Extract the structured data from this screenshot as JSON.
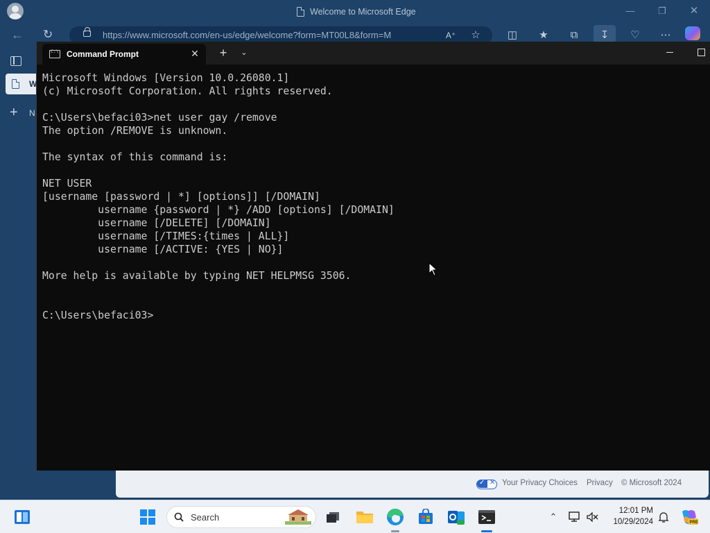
{
  "edge": {
    "window_title": "Welcome to Microsoft Edge",
    "address_url": "https://www.microsoft.com/en-us/edge/welcome?form=MT00L8&form=M",
    "sidebar": {
      "active_tab_label": "W",
      "new_tab_label": "N"
    },
    "footer": {
      "privacy_choices": "Your Privacy Choices",
      "privacy": "Privacy",
      "copyright": "© Microsoft 2024"
    },
    "icons": [
      "profile-avatar-icon",
      "back-arrow-icon",
      "refresh-icon",
      "lock-icon",
      "read-aloud-icon",
      "favorite-star-icon",
      "split-screen-icon",
      "favorites-icon",
      "collections-icon",
      "downloads-icon",
      "browser-essentials-icon",
      "more-icon",
      "copilot-icon"
    ]
  },
  "terminal": {
    "tab_title": "Command Prompt",
    "lines": [
      "Microsoft Windows [Version 10.0.26080.1]",
      "(c) Microsoft Corporation. All rights reserved.",
      "",
      "C:\\Users\\befaci03>net user gay /remove",
      "The option /REMOVE is unknown.",
      "",
      "The syntax of this command is:",
      "",
      "NET USER",
      "[username [password | *] [options]] [/DOMAIN]",
      "         username {password | *} /ADD [options] [/DOMAIN]",
      "         username [/DELETE] [/DOMAIN]",
      "         username [/TIMES:{times | ALL}]",
      "         username [/ACTIVE: {YES | NO}]",
      "",
      "More help is available by typing NET HELPMSG 3506.",
      "",
      "",
      "C:\\Users\\befaci03>"
    ],
    "colors": {
      "background": "#0c0c0c",
      "text": "#cccccc"
    }
  },
  "taskbar": {
    "search_label": "Search",
    "apps": [
      "start-menu",
      "file-explorer-task-view",
      "file-explorer",
      "edge",
      "microsoft-store",
      "outlook",
      "terminal"
    ],
    "clock_time": "12:01 PM",
    "clock_date": "10/29/2024"
  }
}
